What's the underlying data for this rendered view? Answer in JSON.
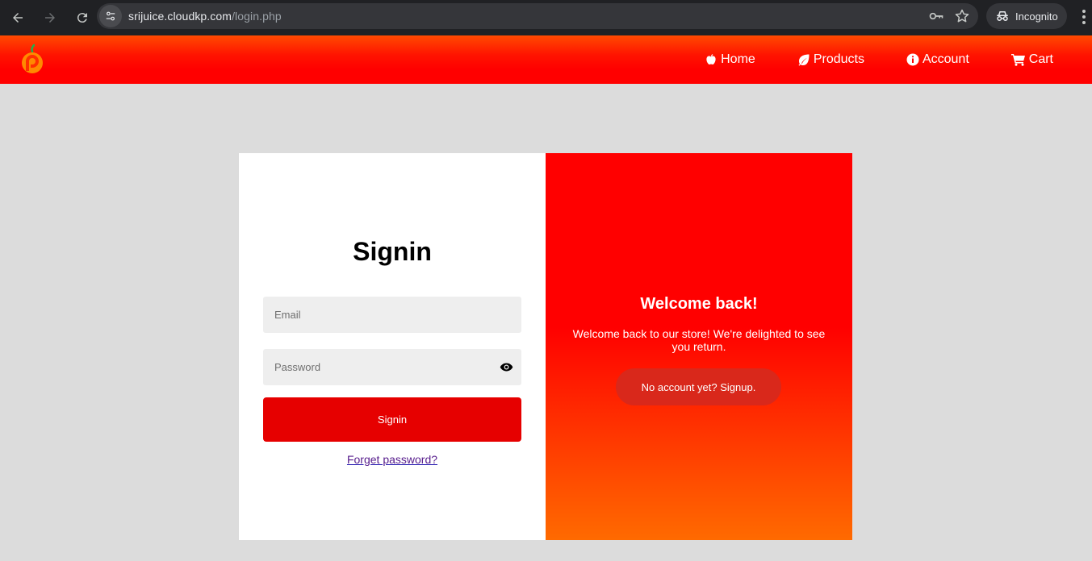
{
  "browser": {
    "url_host": "srijuice.cloudkp.com",
    "url_path": "/login.php",
    "incognito_label": "Incognito"
  },
  "site": {
    "brand_colors": {
      "header": "#ff0000",
      "button": "#e60000",
      "accent": "#ff6a00"
    },
    "nav": [
      {
        "label": "Home",
        "icon": "apple-icon"
      },
      {
        "label": "Products",
        "icon": "leaf-icon"
      },
      {
        "label": "Account",
        "icon": "info-icon"
      },
      {
        "label": "Cart",
        "icon": "cart-icon"
      }
    ]
  },
  "signin": {
    "title": "Signin",
    "email_placeholder": "Email",
    "password_placeholder": "Password",
    "submit_label": "Signin",
    "forgot_label": "Forget password?"
  },
  "welcome": {
    "title": "Welcome back!",
    "text": "Welcome back to our store! We're delighted to see you return.",
    "signup_label": "No account yet? Signup."
  }
}
